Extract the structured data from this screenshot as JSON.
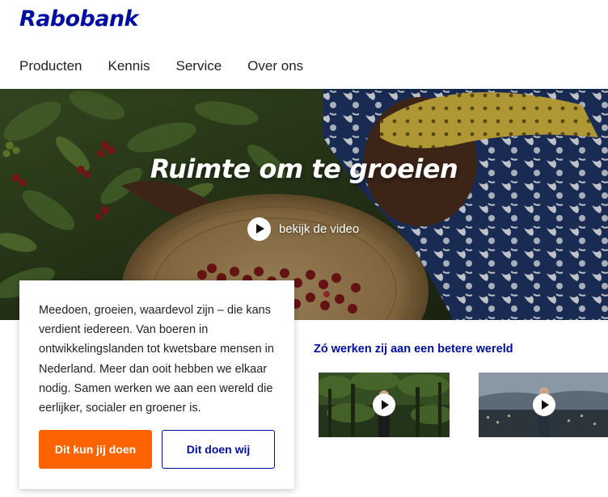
{
  "header": {
    "logo": "Rabobank",
    "nav": [
      "Producten",
      "Kennis",
      "Service",
      "Over ons"
    ]
  },
  "hero": {
    "title": "Ruimte om te groeien",
    "video_label": "bekijk de video"
  },
  "card": {
    "text": "Meedoen, groeien, waardevol zijn – die kans verdient iedereen. Van boeren in ontwikkelingslanden tot kwetsbare mensen in Nederland. Meer dan ooit hebben we elkaar nodig. Samen werken we aan een wereld die eerlijker, socialer en groener is.",
    "primary_button": "Dit kun jij doen",
    "secondary_button": "Dit doen wij"
  },
  "videos": {
    "heading": "Zó werken zij aan een betere wereld"
  },
  "colors": {
    "brand_blue": "#000f9f",
    "accent_orange": "#fd6400"
  }
}
